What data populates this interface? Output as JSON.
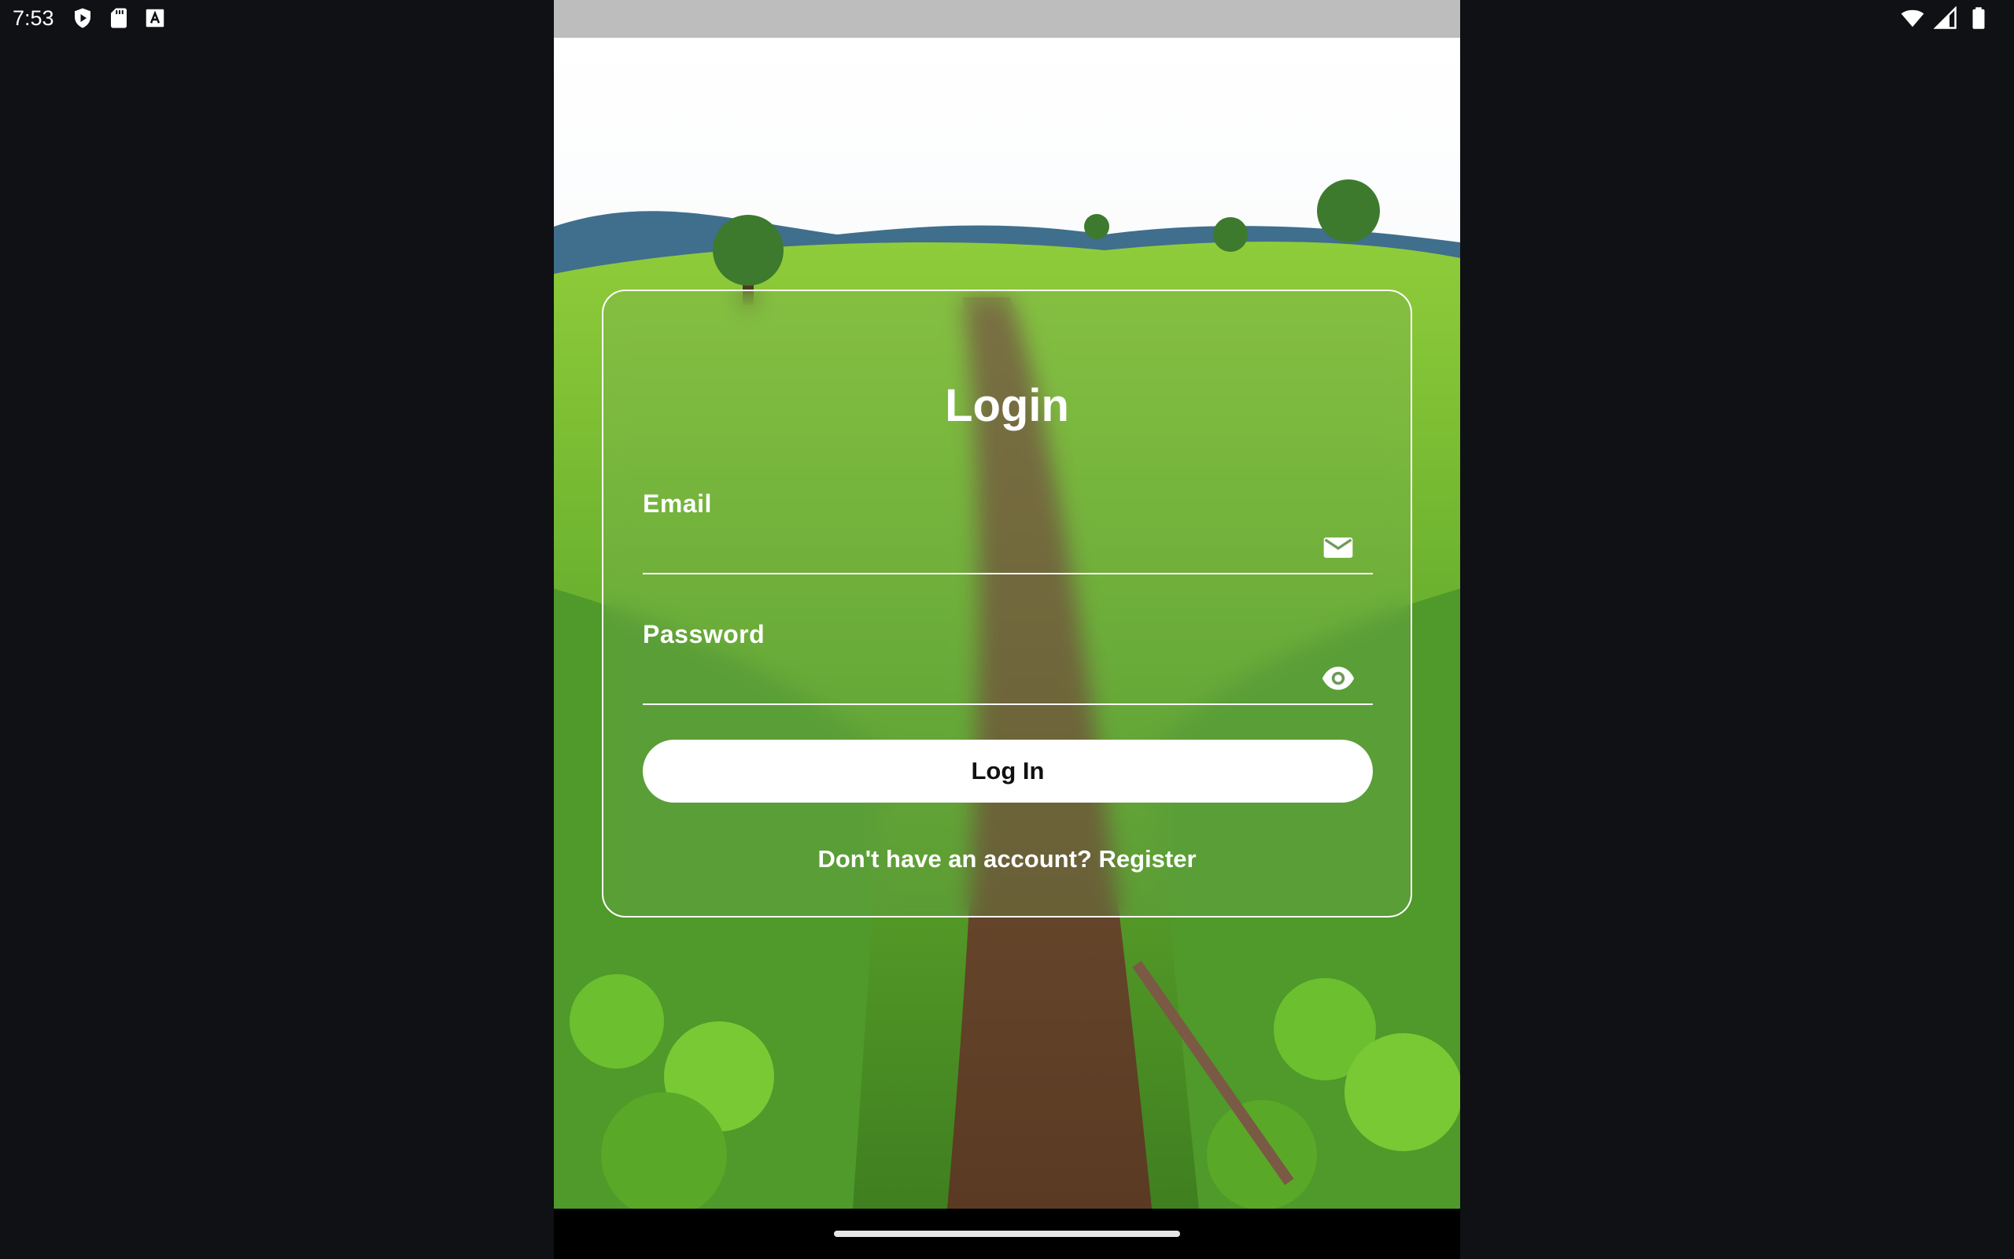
{
  "status_bar": {
    "time": "7:53",
    "left_icons": [
      "play-protect-icon",
      "sd-card-icon",
      "keyboard-a-icon"
    ],
    "right_icons": [
      "wifi-icon",
      "cell-signal-icon",
      "battery-icon"
    ]
  },
  "login": {
    "title": "Login",
    "email": {
      "label": "Email",
      "value": "",
      "icon": "mail-icon"
    },
    "password": {
      "label": "Password",
      "value": "",
      "icon": "eye-icon"
    },
    "submit_label": "Log In",
    "register_link": "Don't have an account? Register"
  },
  "colors": {
    "screen_background": "#0f1115",
    "app_top_bar": "#bdbdbd",
    "card_border": "#ffffff",
    "button_background": "#ffffff",
    "button_text": "#111111",
    "text": "#ffffff"
  }
}
